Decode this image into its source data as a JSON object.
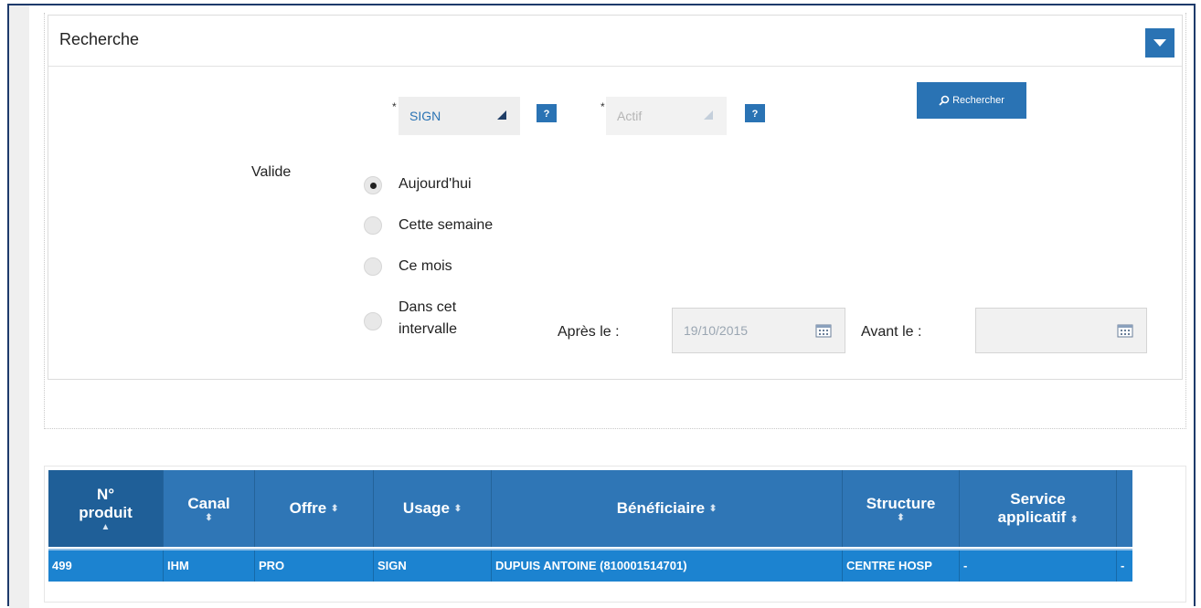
{
  "panel": {
    "title": "Recherche",
    "type_select": {
      "value": "SIGN",
      "required_mark": "*"
    },
    "status_select": {
      "value": "Actif",
      "required_mark": "*"
    },
    "help_label": "?",
    "search_button": "Rechercher",
    "validity_label": "Valide",
    "radios": [
      {
        "label": "Aujourd'hui",
        "checked": true
      },
      {
        "label": "Cette semaine",
        "checked": false
      },
      {
        "label": "Ce mois",
        "checked": false
      },
      {
        "label_line1": "Dans cet",
        "label_line2": "intervalle",
        "checked": false
      }
    ],
    "after_label": "Après le :",
    "after_value": "19/10/2015",
    "before_label": "Avant le :",
    "before_value": ""
  },
  "table": {
    "columns": [
      {
        "line1": "N°",
        "line2": "produit",
        "sort": "▲"
      },
      {
        "line1": "Canal",
        "line2": "",
        "sort": "⬍"
      },
      {
        "line1": "Offre",
        "line2": "",
        "sort": "⬍"
      },
      {
        "line1": "Usage",
        "line2": "",
        "sort": "⬍"
      },
      {
        "line1": "Bénéficiaire",
        "line2": "",
        "sort": "⬍"
      },
      {
        "line1": "Structure",
        "line2": "",
        "sort": "⬍"
      },
      {
        "line1": "Service",
        "line2": "applicatif",
        "sort": "⬍"
      }
    ],
    "rows": [
      {
        "num": "499",
        "canal": "IHM",
        "offre": "PRO",
        "usage": "SIGN",
        "beneficiaire": "DUPUIS ANTOINE (810001514701)",
        "structure": "CENTRE HOSP",
        "service": "-",
        "extra": "-"
      }
    ]
  },
  "colors": {
    "accent": "#2a73b4",
    "header": "#2f76b6",
    "selected_row": "#1c83d0"
  },
  "icons": [
    "chevron-down-icon",
    "help-icon",
    "search-icon",
    "calendar-icon",
    "sort-icon"
  ]
}
